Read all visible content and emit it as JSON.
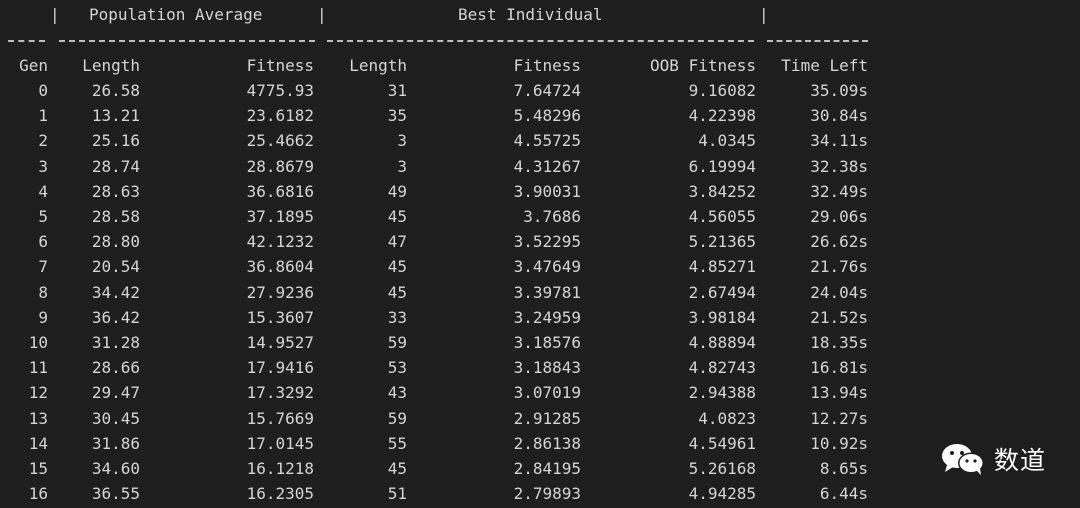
{
  "header": {
    "group_sep_1": "|",
    "group_label_1": "Population Average",
    "group_sep_2": "|",
    "group_label_2": "Best Individual",
    "group_sep_3": "|"
  },
  "columns": [
    "Gen",
    "Length",
    "Fitness",
    "Length",
    "Fitness",
    "OOB Fitness",
    "Time Left"
  ],
  "rows": [
    [
      "0",
      "26.58",
      "4775.93",
      "31",
      "7.64724",
      "9.16082",
      "35.09s"
    ],
    [
      "1",
      "13.21",
      "23.6182",
      "35",
      "5.48296",
      "4.22398",
      "30.84s"
    ],
    [
      "2",
      "25.16",
      "25.4662",
      "3",
      "4.55725",
      "4.0345",
      "34.11s"
    ],
    [
      "3",
      "28.74",
      "28.8679",
      "3",
      "4.31267",
      "6.19994",
      "32.38s"
    ],
    [
      "4",
      "28.63",
      "36.6816",
      "49",
      "3.90031",
      "3.84252",
      "32.49s"
    ],
    [
      "5",
      "28.58",
      "37.1895",
      "45",
      "3.7686",
      "4.56055",
      "29.06s"
    ],
    [
      "6",
      "28.80",
      "42.1232",
      "47",
      "3.52295",
      "5.21365",
      "26.62s"
    ],
    [
      "7",
      "20.54",
      "36.8604",
      "45",
      "3.47649",
      "4.85271",
      "21.76s"
    ],
    [
      "8",
      "34.42",
      "27.9236",
      "45",
      "3.39781",
      "2.67494",
      "24.04s"
    ],
    [
      "9",
      "36.42",
      "15.3607",
      "33",
      "3.24959",
      "3.98184",
      "21.52s"
    ],
    [
      "10",
      "31.28",
      "14.9527",
      "59",
      "3.18576",
      "4.88894",
      "18.35s"
    ],
    [
      "11",
      "28.66",
      "17.9416",
      "53",
      "3.18843",
      "4.82743",
      "16.81s"
    ],
    [
      "12",
      "29.47",
      "17.3292",
      "43",
      "3.07019",
      "2.94388",
      "13.94s"
    ],
    [
      "13",
      "30.45",
      "15.7669",
      "59",
      "2.91285",
      "4.0823",
      "12.27s"
    ],
    [
      "14",
      "31.86",
      "17.0145",
      "55",
      "2.86138",
      "4.54961",
      "10.92s"
    ],
    [
      "15",
      "34.60",
      "16.1218",
      "45",
      "2.84195",
      "5.26168",
      "8.65s"
    ],
    [
      "16",
      "36.55",
      "16.2305",
      "51",
      "2.79893",
      "4.94285",
      "6.44s"
    ]
  ],
  "watermark": {
    "icon": "wechat-icon",
    "text": "数道"
  },
  "colors": {
    "background": "#1e1e1e",
    "text": "#d4d4d4"
  }
}
